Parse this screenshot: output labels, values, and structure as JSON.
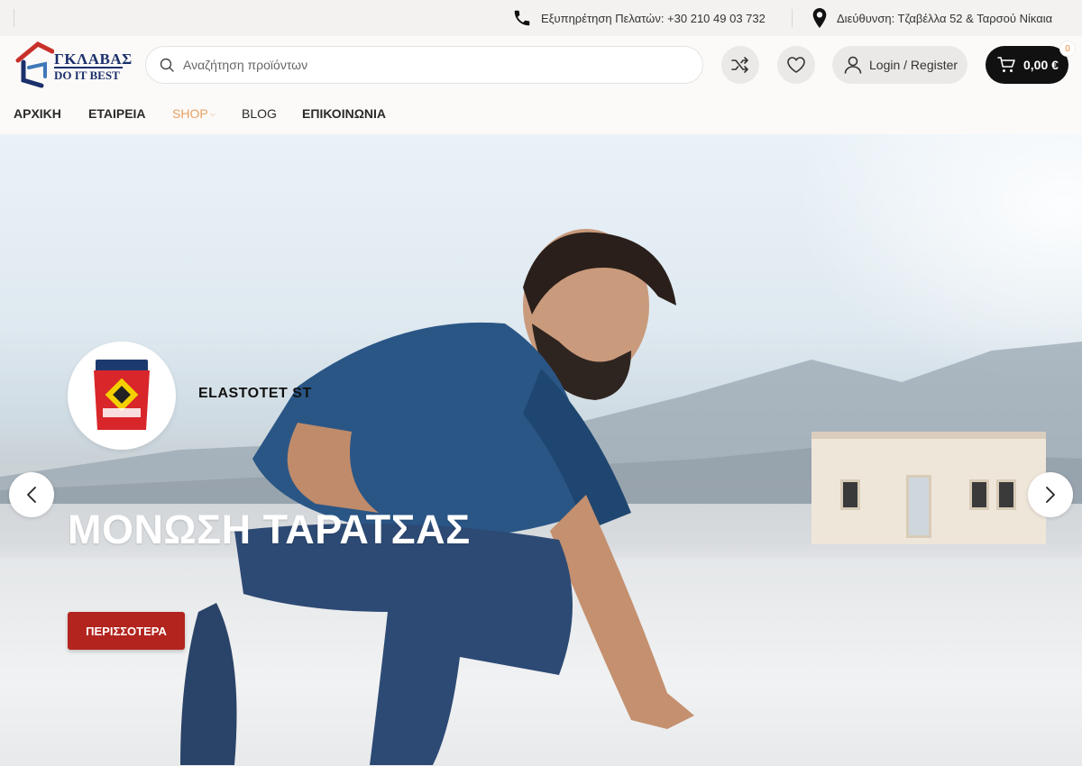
{
  "topbar": {
    "phone_text": "Εξυπηρέτηση Πελατών: +30 210 49 03 732",
    "address_text": "Διεύθυνση: Τζαβέλλα 52 & Ταρσού Νίκαια",
    "phone_icon": "phone-icon",
    "address_icon": "location-pin-icon"
  },
  "header": {
    "logo": {
      "line1": "ΓΚΛΑΒΑΣ",
      "line2": "DO IT BEST"
    },
    "search_placeholder": "Αναζήτηση προϊόντων",
    "login_label": "Login / Register",
    "cart_total": "0,00 €",
    "cart_count": "0"
  },
  "nav": {
    "items": [
      {
        "label": "ΑΡΧΙΚΗ"
      },
      {
        "label": "ΕΤΑΙΡΕΙΑ"
      },
      {
        "label": "SHOP"
      },
      {
        "label": "BLOG"
      },
      {
        "label": "ΕΠΙΚΟΙΝΩΝΙΑ"
      }
    ],
    "active": "SHOP"
  },
  "hero": {
    "product_name": "ELASTOTET ST",
    "title": "ΜΟΝΩΣΗ ΤΑΡΑΤΣΑΣ",
    "button_label": "ΠΕΡΙΣΣΟΤΕΡΑ"
  },
  "colors": {
    "accent": "#e9a061",
    "cta": "#b3241e",
    "brand": "#1b2f6b",
    "cart": "#111111"
  }
}
